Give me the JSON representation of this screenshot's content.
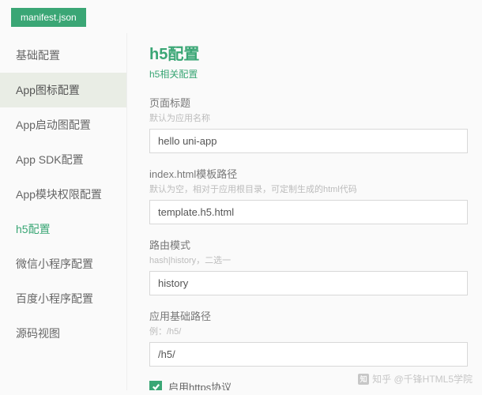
{
  "tab": "manifest.json",
  "sidebar": {
    "items": [
      {
        "label": "基础配置"
      },
      {
        "label": "App图标配置"
      },
      {
        "label": "App启动图配置"
      },
      {
        "label": "App SDK配置"
      },
      {
        "label": "App模块权限配置"
      },
      {
        "label": "h5配置"
      },
      {
        "label": "微信小程序配置"
      },
      {
        "label": "百度小程序配置"
      },
      {
        "label": "源码视图"
      }
    ]
  },
  "main": {
    "title": "h5配置",
    "subtitle": "h5相关配置",
    "fields": {
      "pageTitle": {
        "label": "页面标题",
        "hint": "默认为应用名称",
        "value": "hello uni-app"
      },
      "template": {
        "label": "index.html模板路径",
        "hint": "默认为空，相对于应用根目录，可定制生成的html代码",
        "value": "template.h5.html"
      },
      "routerMode": {
        "label": "路由模式",
        "hint": "hash|history，二选一",
        "value": "history"
      },
      "basePath": {
        "label": "应用基础路径",
        "hint": "例：/h5/",
        "value": "/h5/"
      }
    },
    "httpsLabel": "启用https协议"
  },
  "watermark": "知乎 @千锋HTML5学院"
}
